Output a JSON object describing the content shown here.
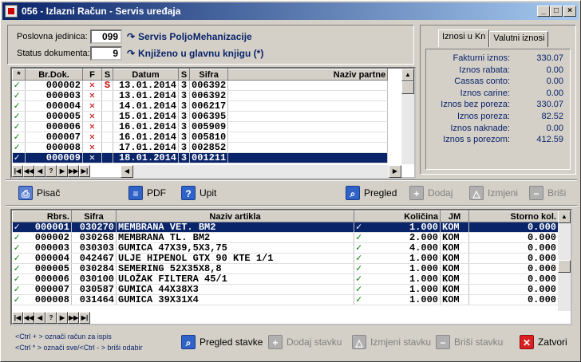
{
  "window": {
    "title": "056 - Izlazni Račun - Servis uređaja"
  },
  "header": {
    "poslovna_label": "Poslovna jedinica:",
    "poslovna_value": "099",
    "poslovna_name": "Servis PoljoMehanizacije",
    "status_label": "Status dokumenta:",
    "status_value": "9",
    "status_name": "Knjiženo u glavnu knjigu (*)"
  },
  "docs": {
    "columns": [
      "*",
      "Br.Dok.",
      "F",
      "S",
      "Datum",
      "S",
      "Sifra",
      "Naziv partne"
    ],
    "rows": [
      {
        "chk": "✓",
        "br": "000002",
        "f": "✕",
        "s": "S",
        "datum": "13.01.2014",
        "s2": "3",
        "sifra": "006392",
        "naziv": "",
        "sel": false
      },
      {
        "chk": "✓",
        "br": "000003",
        "f": "✕",
        "s": "",
        "datum": "13.01.2014",
        "s2": "3",
        "sifra": "006392",
        "naziv": "",
        "sel": false
      },
      {
        "chk": "✓",
        "br": "000004",
        "f": "✕",
        "s": "",
        "datum": "14.01.2014",
        "s2": "3",
        "sifra": "006217",
        "naziv": "",
        "sel": false
      },
      {
        "chk": "✓",
        "br": "000005",
        "f": "✕",
        "s": "",
        "datum": "15.01.2014",
        "s2": "3",
        "sifra": "006395",
        "naziv": "",
        "sel": false
      },
      {
        "chk": "✓",
        "br": "000006",
        "f": "✕",
        "s": "",
        "datum": "16.01.2014",
        "s2": "3",
        "sifra": "005909",
        "naziv": "",
        "sel": false
      },
      {
        "chk": "✓",
        "br": "000007",
        "f": "✕",
        "s": "",
        "datum": "16.01.2014",
        "s2": "3",
        "sifra": "005810",
        "naziv": "",
        "sel": false
      },
      {
        "chk": "✓",
        "br": "000008",
        "f": "✕",
        "s": "",
        "datum": "17.01.2014",
        "s2": "3",
        "sifra": "002852",
        "naziv": "",
        "sel": false
      },
      {
        "chk": "✓",
        "br": "000009",
        "f": "✕",
        "s": "",
        "datum": "18.01.2014",
        "s2": "3",
        "sifra": "001211",
        "naziv": "",
        "sel": true
      }
    ]
  },
  "nav": [
    "|◀",
    "◀◀",
    "◀",
    "?",
    "▶",
    "▶▶",
    "▶|"
  ],
  "toolbar": {
    "pisac": "Pisač",
    "pdf": "PDF",
    "upit": "Upit",
    "pregled": "Pregled",
    "dodaj": "Dodaj",
    "izmjeni": "Izmjeni",
    "brisi": "Briši"
  },
  "summary": {
    "tab_kn": "Iznosi u Kn",
    "tab_val": "Valutni iznosi",
    "rows": [
      {
        "label": "Fakturni iznos:",
        "value": "330.07"
      },
      {
        "label": "Iznos rabata:",
        "value": "0.00"
      },
      {
        "label": "Cassas conto:",
        "value": "0.00"
      },
      {
        "label": "Iznos carine:",
        "value": "0.00"
      },
      {
        "label": "Iznos bez poreza:",
        "value": "330.07"
      },
      {
        "label": "Iznos poreza:",
        "value": "82.52"
      },
      {
        "label": "Iznos naknade:",
        "value": "0.00"
      },
      {
        "label": "Iznos s porezom:",
        "value": "412.59"
      }
    ]
  },
  "items": {
    "columns": [
      "Rbrs.",
      "Sifra",
      "Naziv artikla",
      "Količina",
      "JM",
      "Storno kol."
    ],
    "rows": [
      {
        "chk": "✓",
        "rb": "000001",
        "sifra": "030270",
        "naziv": "MEMBRANA VET. BM2",
        "chk2": "✓",
        "kol": "1.000",
        "jm": "KOM",
        "storno": "0.000",
        "sel": true
      },
      {
        "chk": "✓",
        "rb": "000002",
        "sifra": "030268",
        "naziv": "MEMBRANA TL. BM2",
        "chk2": "✓",
        "kol": "2.000",
        "jm": "KOM",
        "storno": "0.000",
        "sel": false
      },
      {
        "chk": "✓",
        "rb": "000003",
        "sifra": "030303",
        "naziv": "GUMICA 47X39,5X3,75",
        "chk2": "✓",
        "kol": "4.000",
        "jm": "KOM",
        "storno": "0.000",
        "sel": false
      },
      {
        "chk": "✓",
        "rb": "000004",
        "sifra": "042467",
        "naziv": "ULJE HIPENOL GTX 90 KTE 1/1",
        "chk2": "✓",
        "kol": "1.000",
        "jm": "KOM",
        "storno": "0.000",
        "sel": false
      },
      {
        "chk": "✓",
        "rb": "000005",
        "sifra": "030284",
        "naziv": "SEMERING 52X35X8,8",
        "chk2": "✓",
        "kol": "1.000",
        "jm": "KOM",
        "storno": "0.000",
        "sel": false
      },
      {
        "chk": "✓",
        "rb": "000006",
        "sifra": "030100",
        "naziv": "ULOŽAK FILTERA 45/1",
        "chk2": "✓",
        "kol": "1.000",
        "jm": "KOM",
        "storno": "0.000",
        "sel": false
      },
      {
        "chk": "✓",
        "rb": "000007",
        "sifra": "030587",
        "naziv": "GUMICA 44X38X3",
        "chk2": "✓",
        "kol": "1.000",
        "jm": "KOM",
        "storno": "0.000",
        "sel": false
      },
      {
        "chk": "✓",
        "rb": "000008",
        "sifra": "031464",
        "naziv": "GUMICA 39X31X4",
        "chk2": "✓",
        "kol": "1.000",
        "jm": "KOM",
        "storno": "0.000",
        "sel": false
      }
    ]
  },
  "footer": {
    "hint1": "<Ctrl + > označi račun za ispis",
    "hint2": "<Ctrl * > označi sve/<Ctrl - > briši odabir",
    "pregled_stavke": "Pregled stavke",
    "dodaj_stavku": "Dodaj stavku",
    "izmjeni_stavku": "Izmjeni stavku",
    "brisi_stavku": "Briši stavku",
    "zatvori": "Zatvori"
  }
}
